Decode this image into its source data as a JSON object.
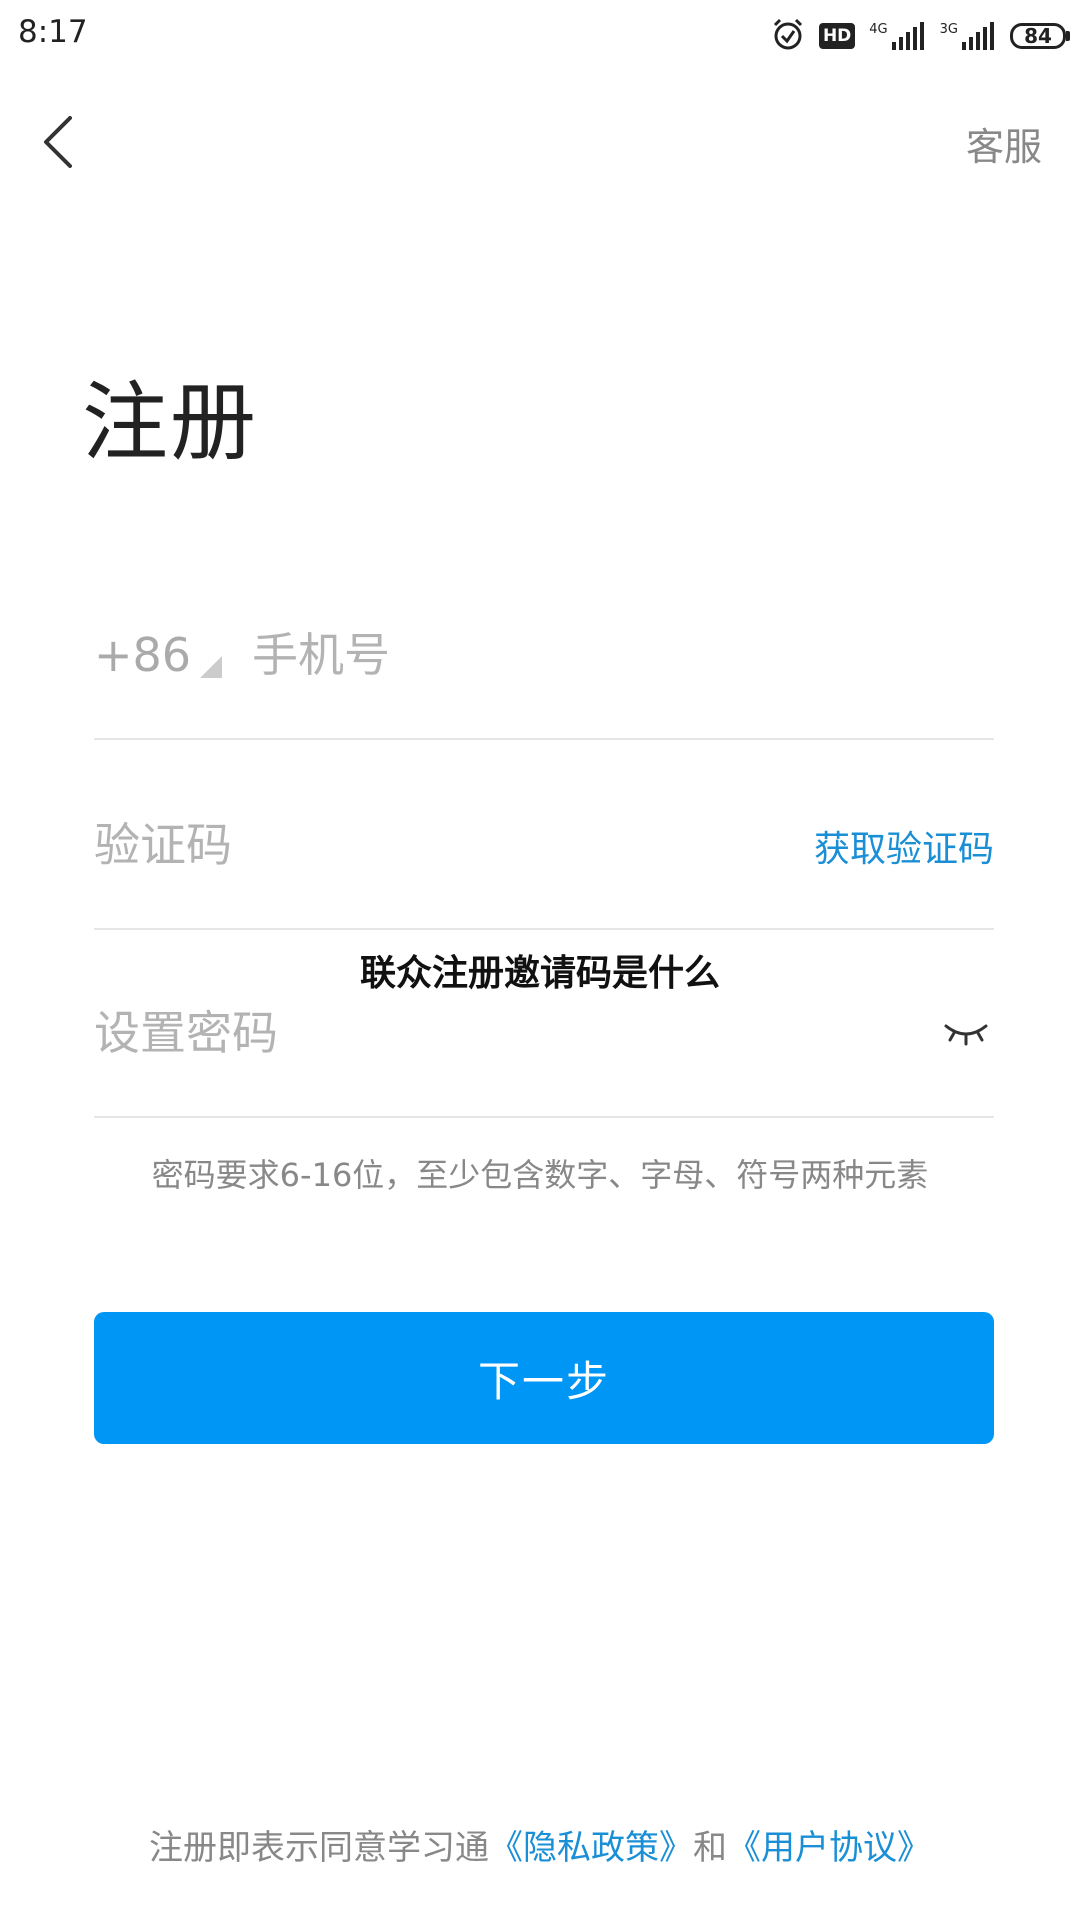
{
  "status_bar": {
    "time": "8:17",
    "hd": "HD",
    "network_1": "4G",
    "network_2": "3G",
    "battery": "84"
  },
  "nav": {
    "customer_service": "客服"
  },
  "title": "注册",
  "phone": {
    "country_code": "+86",
    "placeholder": "手机号"
  },
  "code": {
    "placeholder": "验证码",
    "get_code": "获取验证码"
  },
  "password": {
    "placeholder": "设置密码"
  },
  "password_hint": "密码要求6-16位，至少包含数字、字母、符号两种元素",
  "next_button": "下一步",
  "overlay_caption": "联众注册邀请码是什么",
  "footer": {
    "prefix": "注册即表示同意学习通",
    "privacy_link": "《隐私政策》",
    "conjunction": "和",
    "terms_link": "《用户协议》"
  },
  "colors": {
    "accent": "#0096f5",
    "link": "#1a8fd6"
  }
}
